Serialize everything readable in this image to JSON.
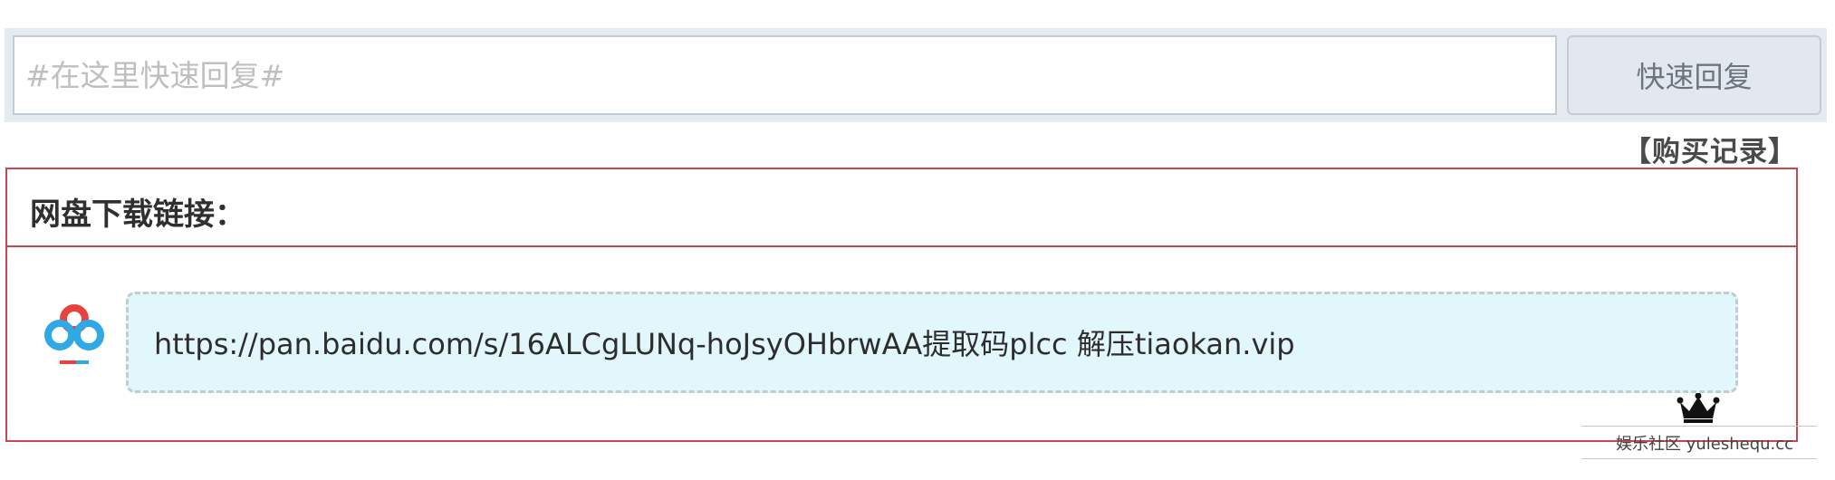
{
  "reply": {
    "placeholder": "#在这里快速回复#",
    "value": "",
    "button_label": "快速回复"
  },
  "purchase_record_label": "【购买记录】",
  "download": {
    "title": "网盘下载链接：",
    "provider_icon": "baidu-netdisk-icon",
    "link_text": "https://pan.baidu.com/s/16ALCgLUNq-hoJsyOHbrwAA提取码plcc 解压tiaokan.vip"
  },
  "watermark": {
    "icon": "crown-icon",
    "text": "娱乐社区 yuleshequ.cc"
  },
  "colors": {
    "border_red": "#c9454f",
    "link_bg": "#e2f7fc",
    "reply_bar_bg": "#e6ebf2"
  }
}
